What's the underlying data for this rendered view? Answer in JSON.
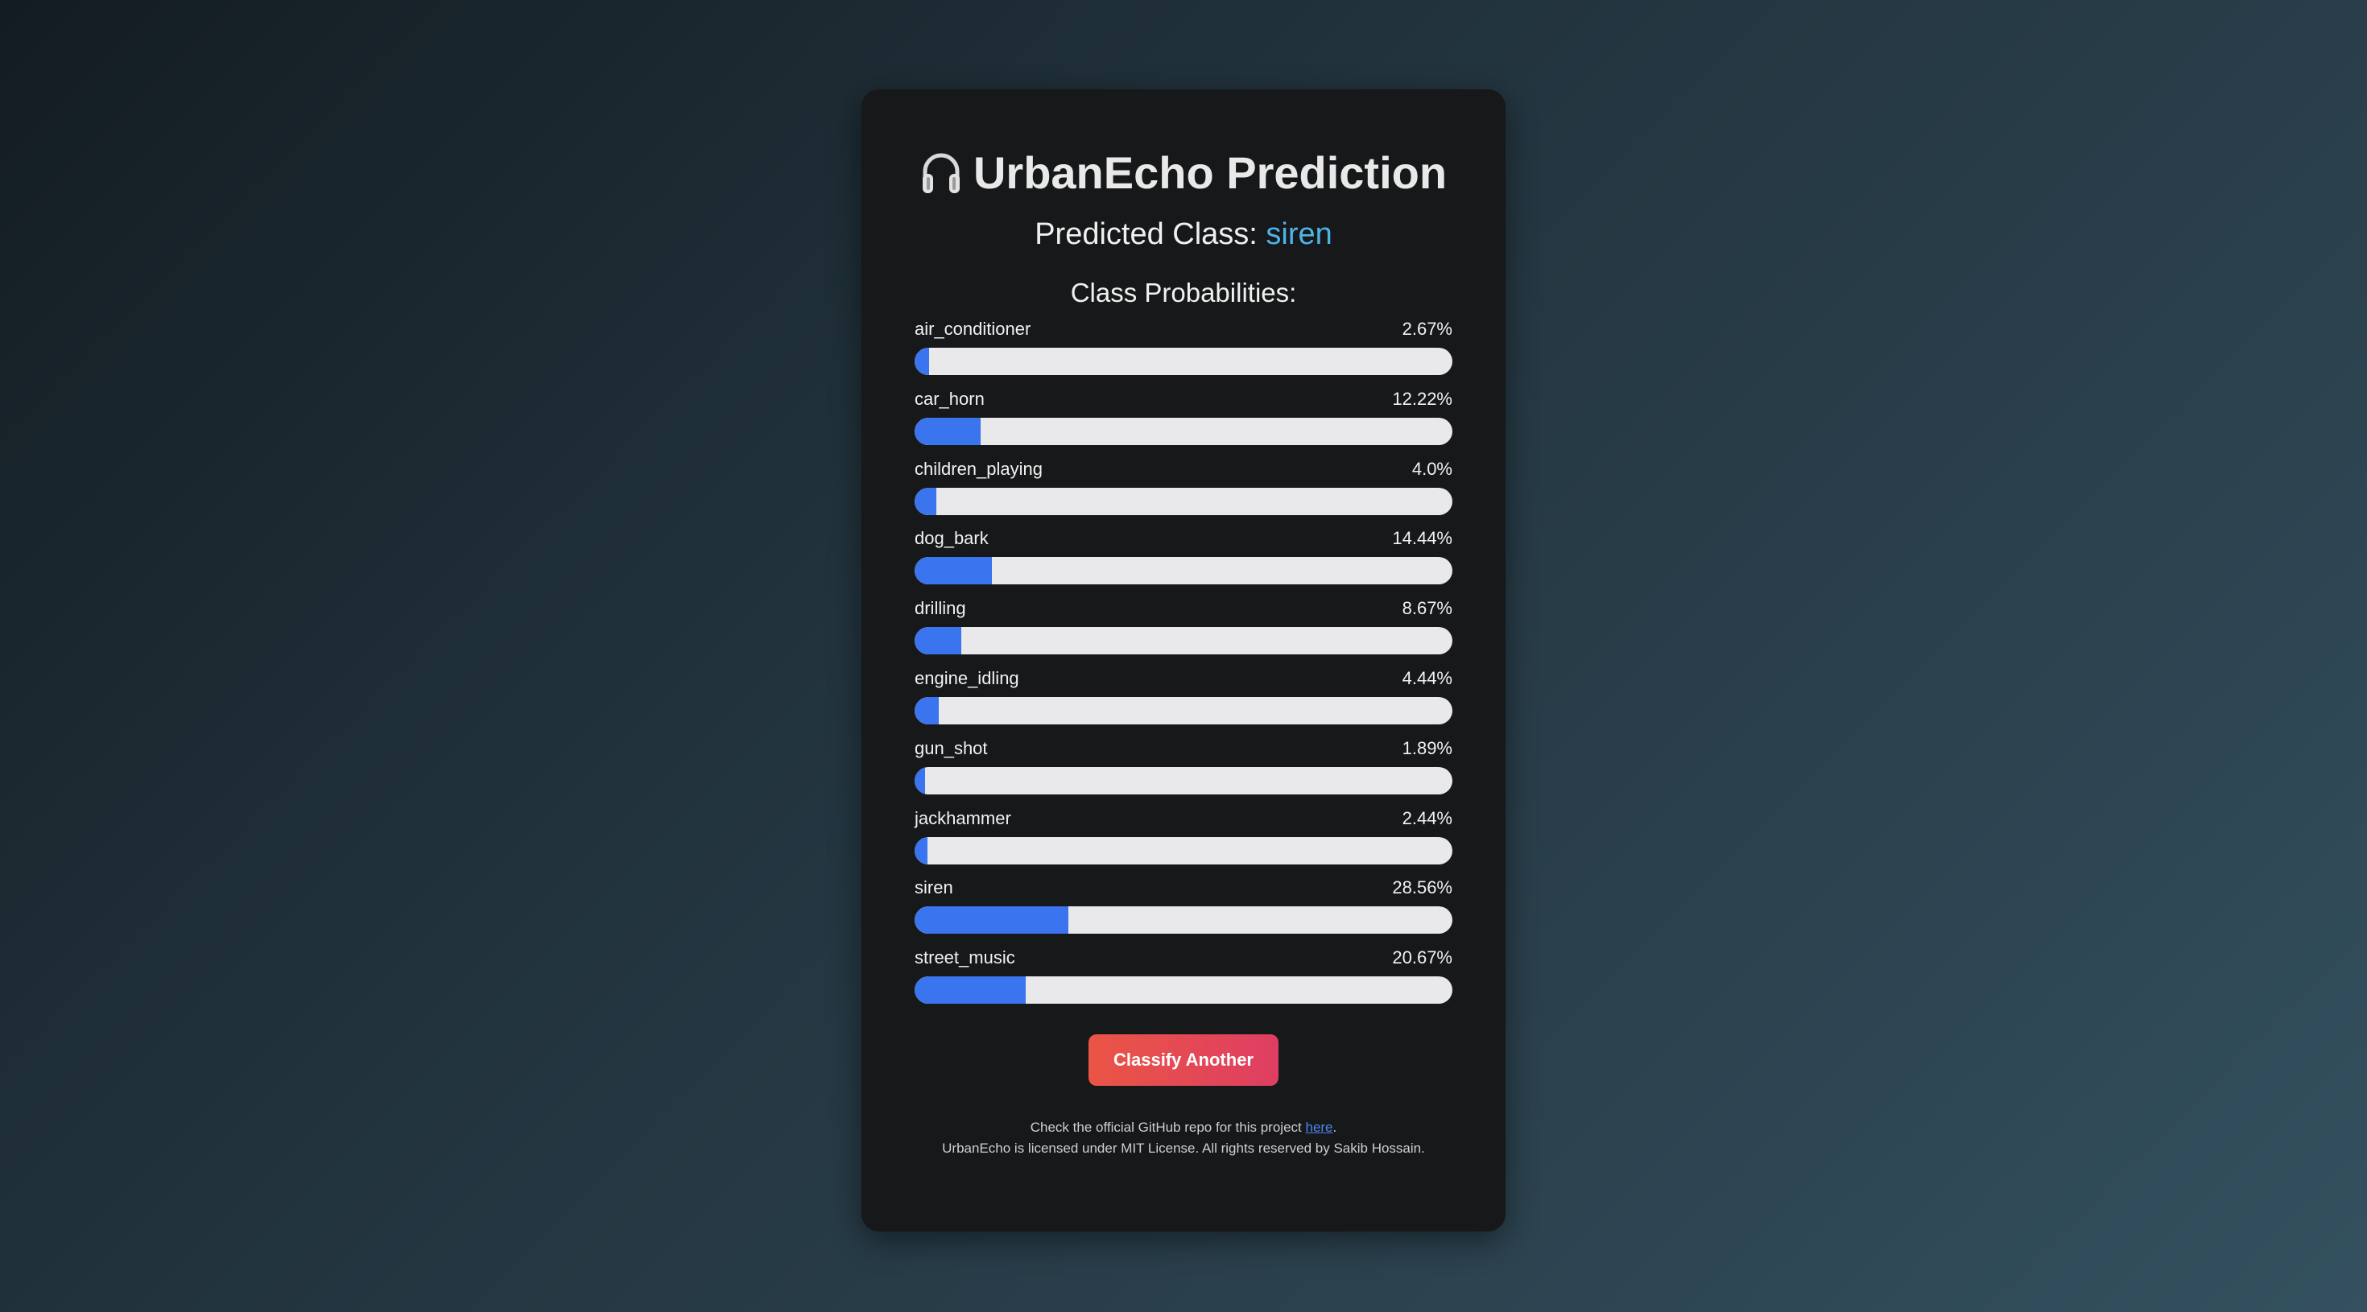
{
  "header": {
    "icon": "headphones-icon",
    "title": "UrbanEcho Prediction"
  },
  "prediction": {
    "label": "Predicted Class: ",
    "class": "siren"
  },
  "probabilities": {
    "heading": "Class Probabilities:",
    "items": [
      {
        "label": "air_conditioner",
        "value": "2.67%",
        "percent": 2.67
      },
      {
        "label": "car_horn",
        "value": "12.22%",
        "percent": 12.22
      },
      {
        "label": "children_playing",
        "value": "4.0%",
        "percent": 4.0
      },
      {
        "label": "dog_bark",
        "value": "14.44%",
        "percent": 14.44
      },
      {
        "label": "drilling",
        "value": "8.67%",
        "percent": 8.67
      },
      {
        "label": "engine_idling",
        "value": "4.44%",
        "percent": 4.44
      },
      {
        "label": "gun_shot",
        "value": "1.89%",
        "percent": 1.89
      },
      {
        "label": "jackhammer",
        "value": "2.44%",
        "percent": 2.44
      },
      {
        "label": "siren",
        "value": "28.56%",
        "percent": 28.56
      },
      {
        "label": "street_music",
        "value": "20.67%",
        "percent": 20.67
      }
    ]
  },
  "actions": {
    "classify_another": "Classify Another"
  },
  "footer": {
    "line1_prefix": "Check the official GitHub repo for this project ",
    "line1_link": "here",
    "line1_suffix": ".",
    "line2": "UrbanEcho is licensed under MIT License. All rights reserved by Sakib Hossain."
  },
  "colors": {
    "accent_class": "#4fb3e8",
    "bar_fill": "#3a74ee",
    "bar_track": "#e9e9ec",
    "button_start": "#ea5545",
    "button_end": "#df3e62",
    "card_bg": "#161819",
    "link": "#4d84f0"
  }
}
